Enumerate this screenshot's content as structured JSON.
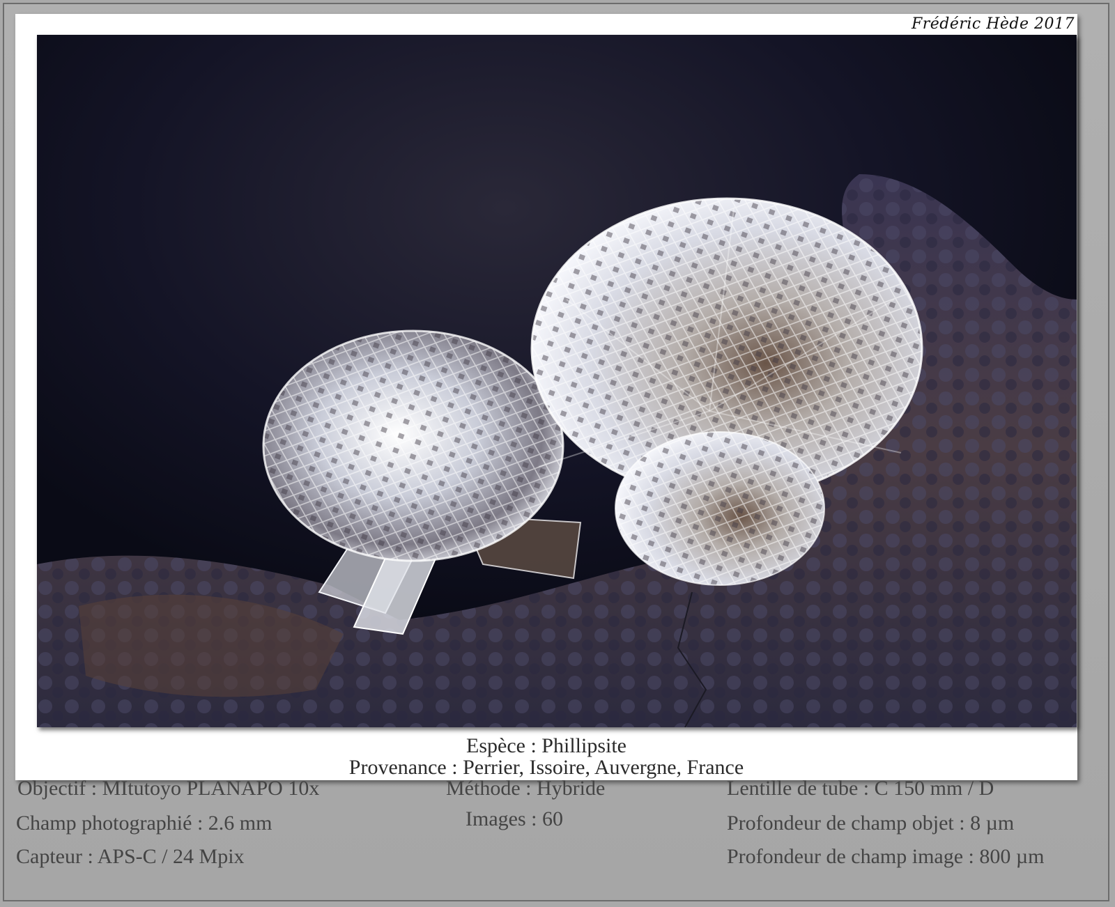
{
  "credit": "Frédéric Hède 2017",
  "caption": {
    "species": "Espèce : Phillipsite",
    "origin": "Provenance : Perrier, Issoire, Auvergne, France"
  },
  "specs": {
    "objective": "Objectif : MItutoyo PLANAPO 10x",
    "field": "Champ photographié : 2.6 mm",
    "sensor": "Capteur : APS-C / 24 Mpix",
    "method": "Méthode : Hybride",
    "images": "Images : 60",
    "tube_lens": "Lentille de tube : C 150 mm / D",
    "object_dof": "Profondeur de champ objet : 8 µm",
    "image_dof": "Profondeur de champ image : 800 µm"
  },
  "colors": {
    "background": "#0c0d1a",
    "matrix": "#3a3550",
    "crystal": "#e4e6ee"
  }
}
